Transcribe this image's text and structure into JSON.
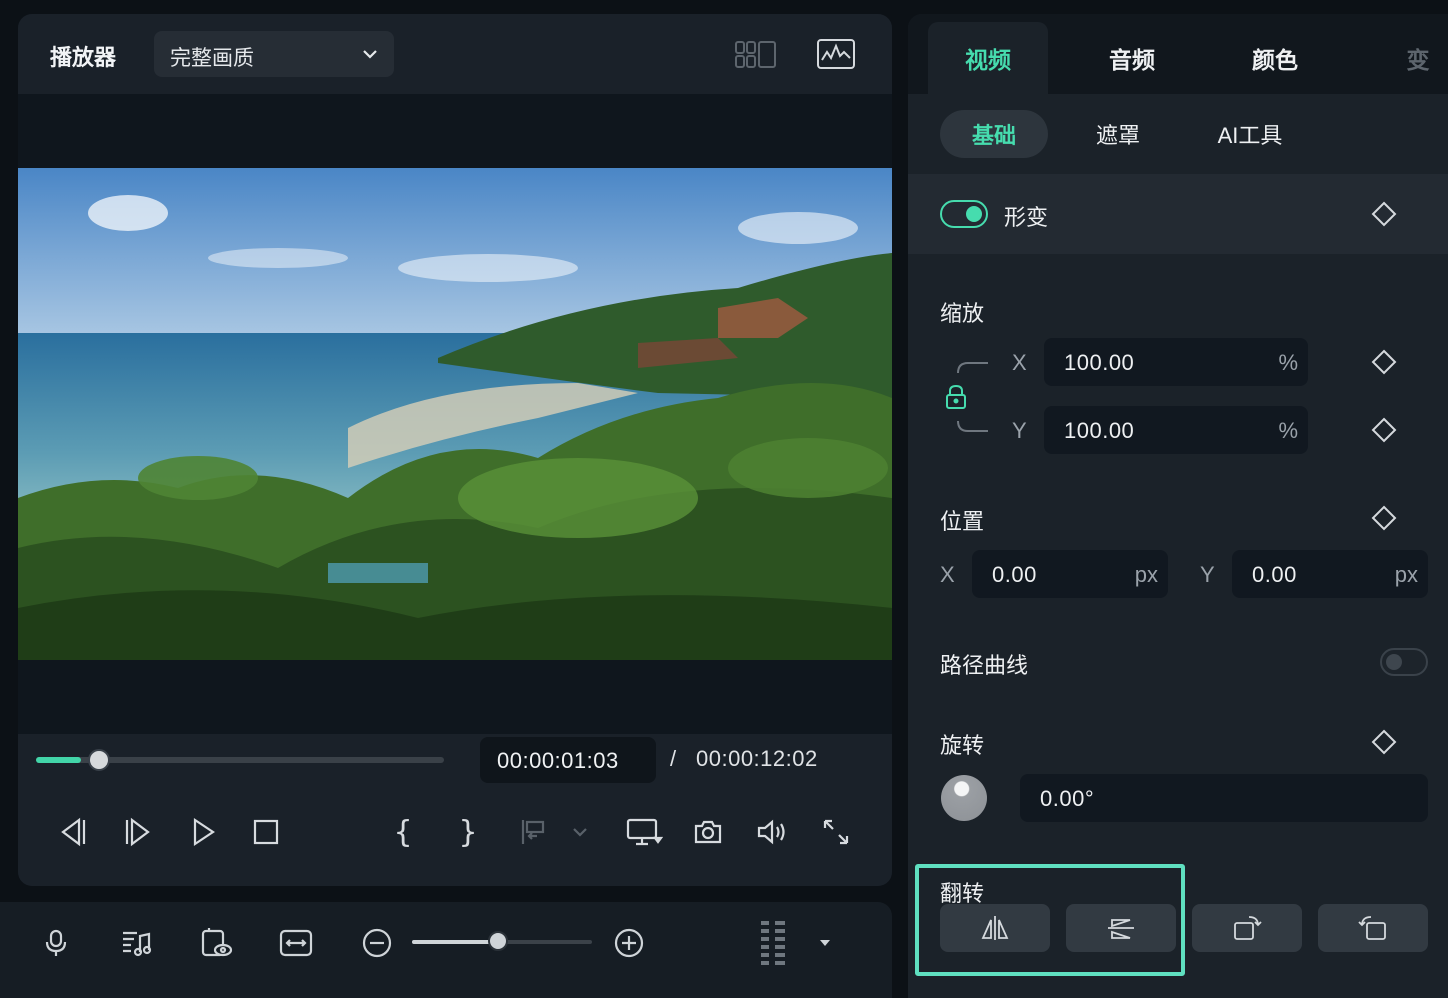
{
  "player": {
    "title": "播放器",
    "quality": "完整画质",
    "current_time": "00:00:01:03",
    "separator": "/",
    "total_time": "00:00:12:02",
    "progress": 0.11,
    "mark_in": "{",
    "mark_out": "}"
  },
  "timeline_toolbar": {
    "zoom_level": 0.48
  },
  "tabs": [
    {
      "label": "视频",
      "active": true
    },
    {
      "label": "音频"
    },
    {
      "label": "颜色"
    },
    {
      "label": "变"
    }
  ],
  "subtabs": [
    {
      "label": "基础",
      "active": true
    },
    {
      "label": "遮罩"
    },
    {
      "label": "AI工具"
    }
  ],
  "transform": {
    "label": "形变",
    "enabled": true
  },
  "scale": {
    "label": "缩放",
    "x_axis": "X",
    "y_axis": "Y",
    "x_value": "100.00",
    "y_value": "100.00",
    "unit": "%"
  },
  "position": {
    "label": "位置",
    "x_axis": "X",
    "y_axis": "Y",
    "x_value": "0.00",
    "y_value": "0.00",
    "unit": "px"
  },
  "path_curve": {
    "label": "路径曲线",
    "enabled": false
  },
  "rotation": {
    "label": "旋转",
    "value": "0.00°"
  },
  "flip": {
    "label": "翻转"
  },
  "colors": {
    "accent": "#46dcae",
    "highlight": "#5fe0c0",
    "panel": "#1b2229",
    "background": "#0c1116"
  }
}
